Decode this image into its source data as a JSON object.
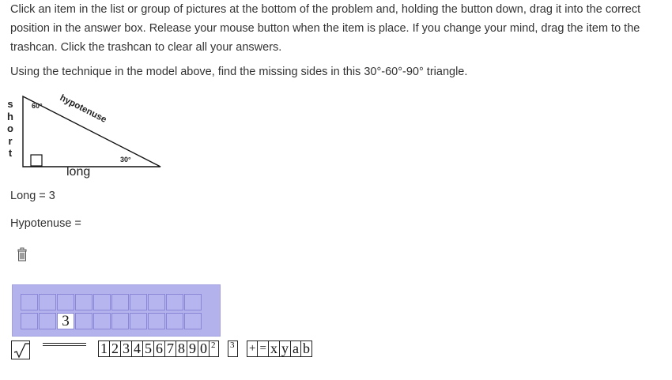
{
  "instructions": "Click an item in the list or group of pictures at the bottom of the problem and, holding the button down, drag it into the correct position in the answer box. Release your mouse button when the item is place. If you change your mind, drag the item to the trashcan. Click the trashcan to clear all your answers.",
  "question": "Using the technique in the model above, find the missing sides in this 30°-60°-90° triangle.",
  "figure": {
    "short_letters": [
      "s",
      "h",
      "o",
      "r",
      "t"
    ],
    "hypotenuse_label": "hypotenuse",
    "long_label": "long",
    "angle_top": "60°",
    "angle_right": "30°"
  },
  "given_line": "Long = 3",
  "hypotenuse_line": "Hypotenuse =",
  "answer_box": {
    "top_row": [
      "",
      "",
      "",
      "",
      "",
      "",
      "",
      "",
      "",
      ""
    ],
    "bottom_row": [
      "",
      "",
      "3",
      "",
      "",
      "",
      "",
      "",
      "",
      ""
    ]
  },
  "palette": {
    "sqrt_symbol": "√",
    "digits": [
      "1",
      "2",
      "3",
      "4",
      "5",
      "6",
      "7",
      "8",
      "9",
      "0"
    ],
    "powers": [
      "2",
      "3"
    ],
    "operators": [
      "+",
      "="
    ],
    "variables": [
      "x",
      "y",
      "a",
      "b"
    ]
  }
}
